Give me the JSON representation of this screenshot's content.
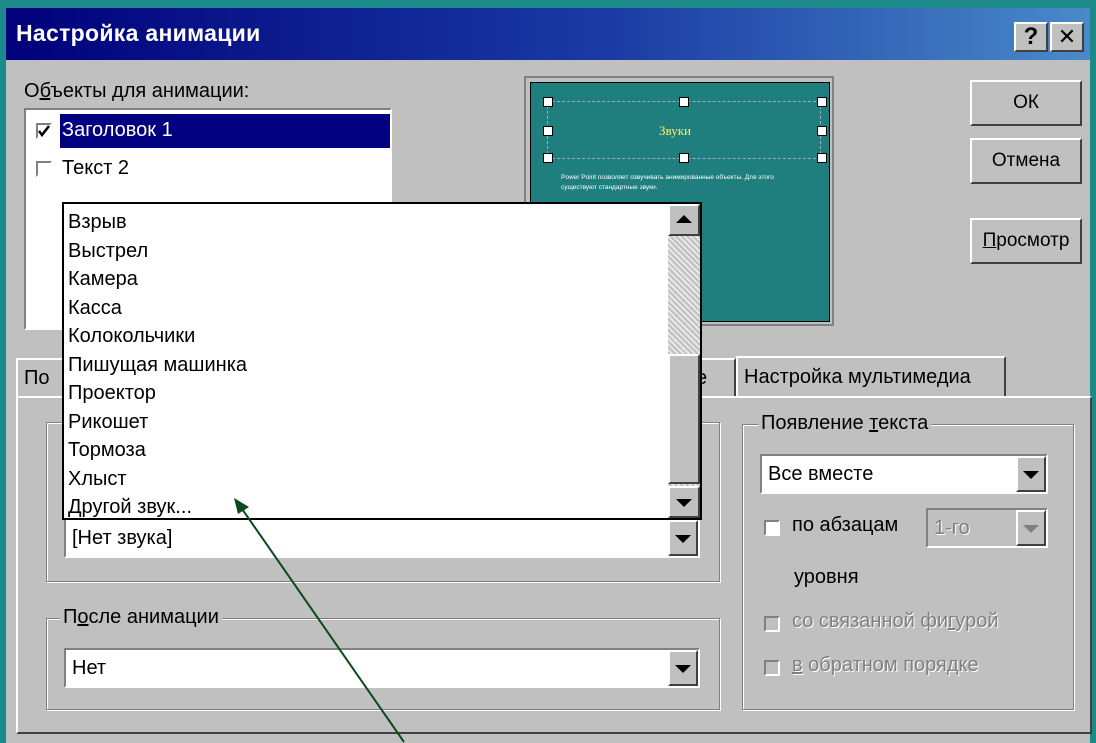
{
  "window": {
    "title": "Настройка анимации",
    "help_label": "?",
    "close_label": "✕"
  },
  "objects": {
    "label_pre": "О",
    "label_u": "б",
    "label_post": "ъекты для анимации:",
    "items": [
      {
        "label": "Заголовок 1",
        "checked": true
      },
      {
        "label": "Текст 2",
        "checked": false
      }
    ]
  },
  "preview": {
    "title": "Звуки",
    "body": "Power Point позволяет озвучивать анимированные объекты. Для этого существуют стандартные звуки."
  },
  "buttons": {
    "ok": "ОК",
    "cancel": "Отмена",
    "preview_u": "П",
    "preview_rest": "росмотр"
  },
  "tabs": [
    {
      "label": "По"
    },
    {
      "label": "е"
    },
    {
      "label": "Настройка мультимедиа"
    }
  ],
  "sound_dropdown": {
    "items": [
      "Взрыв",
      "Выстрел",
      "Камера",
      "Касса",
      "Колокольчики",
      "Пишущая машинка",
      "Проектор",
      "Рикошет",
      "Тормоза",
      "Хлыст",
      "Другой звук..."
    ]
  },
  "sound_combo": {
    "value": "[Нет звука]"
  },
  "after_animation": {
    "label_pre": "П",
    "label_u": "о",
    "label_post": "сле анимации",
    "value": "Нет"
  },
  "text_appearance": {
    "label_pre": "Появление ",
    "label_u": "т",
    "label_post": "екста",
    "value": "Все вместе",
    "by_paragraph_label": "по абзацам",
    "level_value": "1-го",
    "level_label": "уровня",
    "linked_shape_pre": "со связанной фи",
    "linked_shape_u": "г",
    "linked_shape_post": "урой",
    "reverse_u": "в",
    "reverse_post": " обратном порядке"
  },
  "colors": {
    "title_start": "#00007b",
    "title_end": "#4a8ac9",
    "selection": "#000080",
    "slide_bg": "#1f7f7f",
    "arrow": "#0a4a1a"
  }
}
